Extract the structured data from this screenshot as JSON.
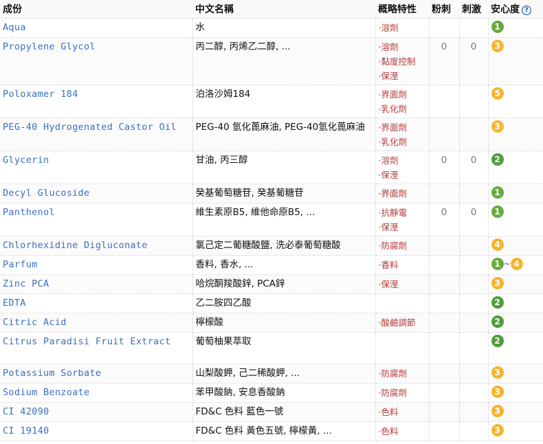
{
  "header": {
    "ingredient": "成份",
    "chinese_name": "中文名稱",
    "properties": "概略特性",
    "acne": "粉刺",
    "irritation": "刺激",
    "safety": "安心度",
    "help_glyph": "?"
  },
  "colors": {
    "safety_1": "#6aab3f",
    "safety_2": "#4f9e3c",
    "safety_3": "#f5b52e",
    "safety_4": "#f5b52e",
    "safety_5": "#f5b52e"
  },
  "rows": [
    {
      "name": "Aqua",
      "cn": "水",
      "props": [
        "·溶劑"
      ],
      "acne": "",
      "irritation": "",
      "safety": [
        "1"
      ]
    },
    {
      "name": "Propylene Glycol",
      "cn": "丙二醇, 丙烯乙二醇, ...",
      "props": [
        "·溶劑",
        "·黏度控制",
        "·保溼"
      ],
      "acne": "0",
      "irritation": "0",
      "safety": [
        "3"
      ]
    },
    {
      "name": "Poloxamer 184",
      "cn": "泊洛沙姆184",
      "props": [
        "·界面劑",
        "·乳化劑"
      ],
      "acne": "",
      "irritation": "",
      "safety": [
        "5"
      ]
    },
    {
      "name": "PEG-40 Hydrogenated Castor Oil",
      "cn": "PEG-40 氫化蓖麻油, PEG-40氫化蓖麻油",
      "props": [
        "·界面劑",
        "·乳化劑"
      ],
      "acne": "",
      "irritation": "",
      "safety": [
        "3"
      ]
    },
    {
      "name": "Glycerin",
      "cn": "甘油, 丙三醇",
      "props": [
        "·溶劑",
        "·保溼"
      ],
      "acne": "0",
      "irritation": "0",
      "safety": [
        "2"
      ]
    },
    {
      "name": "Decyl Glucoside",
      "cn": "癸基葡萄糖苷, 癸基葡糖苷",
      "props": [
        "·界面劑"
      ],
      "acne": "",
      "irritation": "",
      "safety": [
        "1"
      ]
    },
    {
      "name": "Panthenol",
      "cn": "維生素原B5, 維他命原B5, ...",
      "props": [
        "·抗靜電",
        "·保溼"
      ],
      "acne": "0",
      "irritation": "0",
      "safety": [
        "1"
      ]
    },
    {
      "name": "Chlorhexidine Digluconate",
      "cn": "氯己定二葡糖酸鹽, 洗必泰葡萄糖酸",
      "props": [
        "·防腐劑"
      ],
      "acne": "",
      "irritation": "",
      "safety": [
        "4"
      ]
    },
    {
      "name": "Parfum",
      "cn": "香料, 香水, ...",
      "props": [
        "·香料"
      ],
      "acne": "",
      "irritation": "",
      "safety": [
        "1",
        "4"
      ],
      "safety_sep": "~"
    },
    {
      "name": "Zinc PCA",
      "cn": "哈烷酮羧酸鋅, PCA鋅",
      "props": [
        "·保溼"
      ],
      "acne": "",
      "irritation": "",
      "safety": [
        "3"
      ]
    },
    {
      "name": "EDTA",
      "cn": "乙二胺四乙酸",
      "props": [],
      "acne": "",
      "irritation": "",
      "safety": [
        "2"
      ]
    },
    {
      "name": "Citric Acid",
      "cn": "檸檬酸",
      "props": [
        "·酸鹼調節"
      ],
      "acne": "",
      "irritation": "",
      "safety": [
        "2"
      ]
    },
    {
      "name": "Citrus Paradisi Fruit Extract",
      "cn": "葡萄柚果萃取",
      "props": [],
      "acne": "",
      "irritation": "",
      "safety": [
        "2"
      ]
    },
    {
      "name": "Potassium Sorbate",
      "cn": "山梨酸鉀, 己二稀酸鉀, ...",
      "props": [
        "·防腐劑"
      ],
      "acne": "",
      "irritation": "",
      "safety": [
        "3"
      ]
    },
    {
      "name": "Sodium Benzoate",
      "cn": "苯甲酸鈉, 安息香酸鈉",
      "props": [
        "·防腐劑"
      ],
      "acne": "",
      "irritation": "",
      "safety": [
        "3"
      ]
    },
    {
      "name": "CI 42090",
      "cn": "FD&C 色料 藍色一號",
      "props": [
        "·色料"
      ],
      "acne": "",
      "irritation": "",
      "safety": [
        "3"
      ]
    },
    {
      "name": "CI 19140",
      "cn": "FD&C 色料 黃色五號, 檸檬黃, ...",
      "props": [
        "·色料"
      ],
      "acne": "",
      "irritation": "",
      "safety": [
        "3"
      ]
    }
  ]
}
